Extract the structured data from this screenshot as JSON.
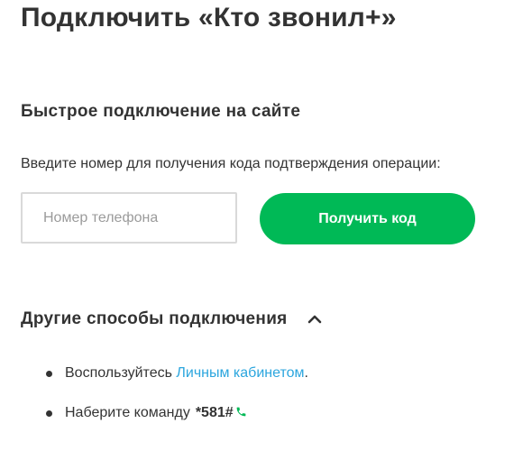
{
  "page": {
    "title": "Подключить «Кто звонил+»"
  },
  "quick_connect": {
    "title": "Быстрое подключение на сайте",
    "instruction": "Введите номер для получения кода подтверждения операции:",
    "phone_placeholder": "Номер телефона",
    "phone_value": "",
    "submit_label": "Получить код"
  },
  "other_methods": {
    "title": "Другие способы подключения",
    "expanded": true,
    "toggle_icon": "chevron-up-icon",
    "items": [
      {
        "prefix": "Воспользуйтесь ",
        "link": "Личным кабинетом",
        "suffix": "."
      },
      {
        "prefix": "Наберите команду",
        "code": "*581#",
        "icon": "phone-call-icon"
      }
    ]
  },
  "colors": {
    "accent": "#00b956",
    "link": "#2ca6de",
    "text": "#333333",
    "input_border": "#d9d9d9",
    "placeholder": "#9b9b9b"
  }
}
